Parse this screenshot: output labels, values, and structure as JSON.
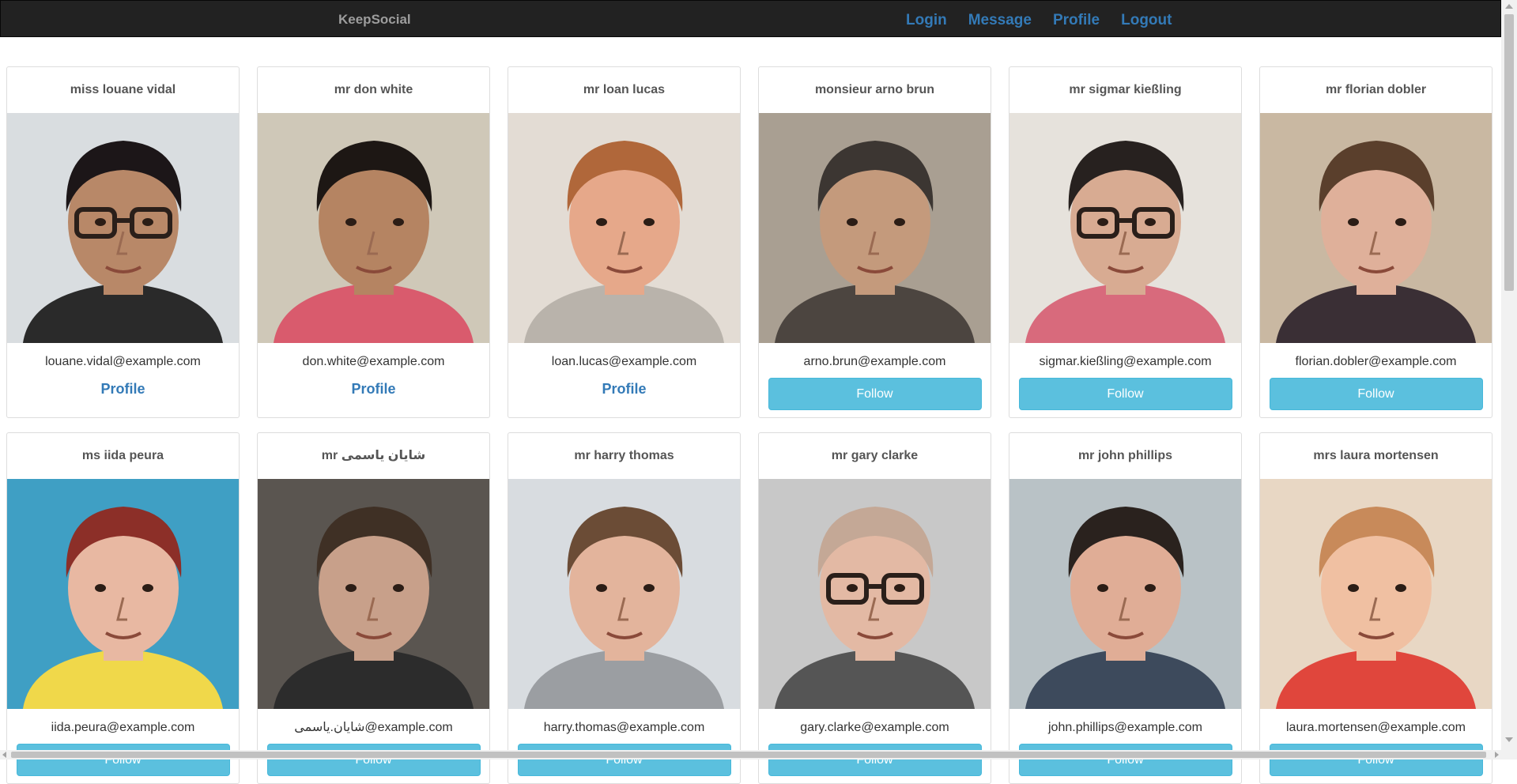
{
  "nav": {
    "brand": "KeepSocial",
    "links": [
      "Login",
      "Message",
      "Profile",
      "Logout"
    ]
  },
  "users": [
    {
      "name": "miss louane vidal",
      "email": "louane.vidal@example.com",
      "action": "profile",
      "action_label": "Profile",
      "photo": {
        "bg": "#d9dde0",
        "skin": "#b88868",
        "hair": "#1c1618",
        "shirt": "#2a2a2a",
        "glasses": true
      }
    },
    {
      "name": "mr don white",
      "email": "don.white@example.com",
      "action": "profile",
      "action_label": "Profile",
      "photo": {
        "bg": "#cfc8b8",
        "skin": "#b58462",
        "hair": "#1d1714",
        "shirt": "#d95b6d",
        "glasses": false
      }
    },
    {
      "name": "mr loan lucas",
      "email": "loan.lucas@example.com",
      "action": "profile",
      "action_label": "Profile",
      "photo": {
        "bg": "#e3dcd4",
        "skin": "#e6a88a",
        "hair": "#b0673a",
        "shirt": "#b9b3ab",
        "glasses": false
      }
    },
    {
      "name": "monsieur arno brun",
      "email": "arno.brun@example.com",
      "action": "follow",
      "action_label": "Follow",
      "photo": {
        "bg": "#a99f92",
        "skin": "#c49a7c",
        "hair": "#3c3632",
        "shirt": "#4c4540",
        "glasses": false
      }
    },
    {
      "name": "mr sigmar kießling",
      "email": "sigmar.kießling@example.com",
      "action": "follow",
      "action_label": "Follow",
      "photo": {
        "bg": "#e6e2dc",
        "skin": "#d8ab92",
        "hair": "#27211f",
        "shirt": "#d86a7c",
        "glasses": true
      }
    },
    {
      "name": "mr florian dobler",
      "email": "florian.dobler@example.com",
      "action": "follow",
      "action_label": "Follow",
      "photo": {
        "bg": "#c9b8a2",
        "skin": "#dfb09a",
        "hair": "#5a3f2c",
        "shirt": "#3a2f35",
        "glasses": false
      }
    },
    {
      "name": "ms iida peura",
      "email": "iida.peura@example.com",
      "action": "follow",
      "action_label": "Follow",
      "photo": {
        "bg": "#3f9fc4",
        "skin": "#e8b8a2",
        "hair": "#8c2f28",
        "shirt": "#f0d84a",
        "glasses": false
      }
    },
    {
      "name": "mr شایان یاسمی",
      "email": "شایان.یاسمی@example.com",
      "action": "follow",
      "action_label": "Follow",
      "photo": {
        "bg": "#5a5550",
        "skin": "#c8a08a",
        "hair": "#3f3025",
        "shirt": "#2c2c2c",
        "glasses": false
      }
    },
    {
      "name": "mr harry thomas",
      "email": "harry.thomas@example.com",
      "action": "follow",
      "action_label": "Follow",
      "photo": {
        "bg": "#d8dce0",
        "skin": "#e3b49c",
        "hair": "#6b4c36",
        "shirt": "#9b9ea2",
        "glasses": false
      }
    },
    {
      "name": "mr gary clarke",
      "email": "gary.clarke@example.com",
      "action": "follow",
      "action_label": "Follow",
      "photo": {
        "bg": "#c8c8c8",
        "skin": "#e3b9a4",
        "hair": "#c4a896",
        "shirt": "#555555",
        "glasses": true
      }
    },
    {
      "name": "mr john phillips",
      "email": "john.phillips@example.com",
      "action": "follow",
      "action_label": "Follow",
      "photo": {
        "bg": "#b9c2c6",
        "skin": "#e0ad96",
        "hair": "#2a221e",
        "shirt": "#3d4a5c",
        "glasses": false
      }
    },
    {
      "name": "mrs laura mortensen",
      "email": "laura.mortensen@example.com",
      "action": "follow",
      "action_label": "Follow",
      "photo": {
        "bg": "#e8d7c4",
        "skin": "#f0c0a2",
        "hair": "#c88a5a",
        "shirt": "#e0463c",
        "glasses": false
      }
    }
  ]
}
